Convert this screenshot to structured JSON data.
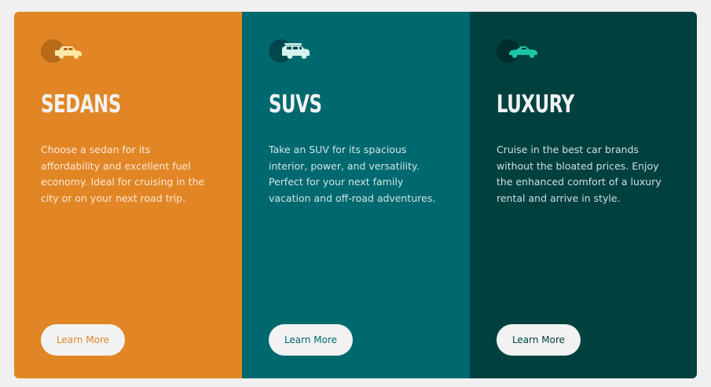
{
  "colors": {
    "page_bg": "#f0f0f0",
    "button_bg": "#f2f2f2",
    "heading": "#f2f2f2",
    "body_text": "rgba(255,255,255,0.82)"
  },
  "cards": [
    {
      "icon": "sedan-icon",
      "title": "Sedans",
      "description": "Choose a sedan for its affordability and excellent fuel economy. Ideal for cruising in the city or on your next road trip.",
      "button_label": "Learn More",
      "bg_color": "#e28625",
      "accent_color": "#e28625",
      "icon_circle_color": "#b86a18",
      "icon_color": "#ffe9a8"
    },
    {
      "icon": "suv-icon",
      "title": "SUVs",
      "description": "Take an SUV for its spacious interior, power, and versatility. Perfect for your next family vacation and off-road adventures.",
      "button_label": "Learn More",
      "bg_color": "#006970",
      "accent_color": "#006970",
      "icon_circle_color": "#00484e",
      "icon_color": "#d4f3ee"
    },
    {
      "icon": "luxury-car-icon",
      "title": "Luxury",
      "description": "Cruise in the best car brands without the bloated prices. Enjoy the enhanced comfort of a luxury rental and arrive in style.",
      "button_label": "Learn More",
      "bg_color": "#004140",
      "accent_color": "#004140",
      "icon_circle_color": "#002e2d",
      "icon_color": "#19c7a5"
    }
  ]
}
